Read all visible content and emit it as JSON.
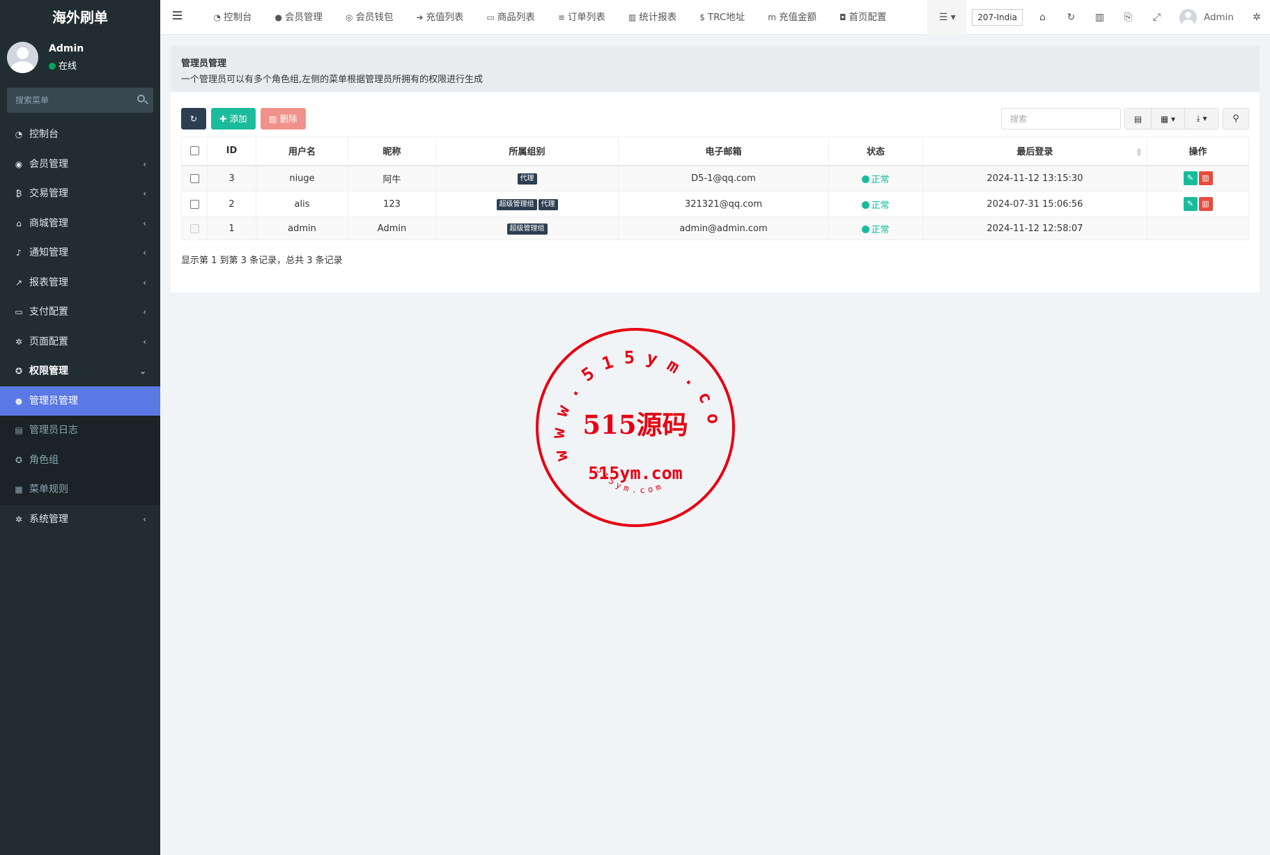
{
  "app": {
    "logo": "海外刷单"
  },
  "user": {
    "name": "Admin",
    "status": "在线"
  },
  "sidebar": {
    "search_placeholder": "搜索菜单",
    "items": [
      {
        "label": "控制台",
        "icon": "dashboard-icon",
        "glyph": "◔"
      },
      {
        "label": "会员管理",
        "icon": "user-circle-icon",
        "glyph": "◉"
      },
      {
        "label": "交易管理",
        "icon": "bitcoin-icon",
        "glyph": "₿"
      },
      {
        "label": "商城管理",
        "icon": "home-icon",
        "glyph": "⌂"
      },
      {
        "label": "通知管理",
        "icon": "bell-icon",
        "glyph": "♪"
      },
      {
        "label": "报表管理",
        "icon": "line-chart-icon",
        "glyph": "↗"
      },
      {
        "label": "支付配置",
        "icon": "credit-card-icon",
        "glyph": "▭"
      },
      {
        "label": "页面配置",
        "icon": "gear-icon",
        "glyph": "✲"
      },
      {
        "label": "权限管理",
        "icon": "group-icon",
        "glyph": "✪"
      }
    ],
    "sub_items": [
      {
        "label": "管理员管理",
        "icon": "user-icon",
        "glyph": "●"
      },
      {
        "label": "管理员日志",
        "icon": "list-icon",
        "glyph": "▤"
      },
      {
        "label": "角色组",
        "icon": "group-icon",
        "glyph": "✪"
      },
      {
        "label": "菜单规则",
        "icon": "windows-icon",
        "glyph": "▦"
      }
    ],
    "last_item": {
      "label": "系统管理",
      "icon": "cogs-icon",
      "glyph": "✲"
    }
  },
  "navbar": {
    "links": [
      {
        "label": "控制台",
        "glyph": "◔",
        "icon": "dashboard-icon"
      },
      {
        "label": "会员管理",
        "glyph": "●",
        "icon": "user-icon"
      },
      {
        "label": "会员钱包",
        "glyph": "◎",
        "icon": "wallet-icon"
      },
      {
        "label": "充值列表",
        "glyph": "➜",
        "icon": "sign-in-icon"
      },
      {
        "label": "商品列表",
        "glyph": "▭",
        "icon": "desktop-icon"
      },
      {
        "label": "订单列表",
        "glyph": "≡",
        "icon": "list-icon"
      },
      {
        "label": "统计报表",
        "glyph": "▥",
        "icon": "bar-chart-icon"
      },
      {
        "label": "TRC地址",
        "glyph": "$",
        "icon": "dollar-icon"
      },
      {
        "label": "充值金额",
        "glyph": "m",
        "icon": "money-icon"
      },
      {
        "label": "首页配置",
        "glyph": "◘",
        "icon": "save-icon"
      }
    ],
    "region": "207-India",
    "user": "Admin"
  },
  "page": {
    "title": "管理员管理",
    "description": "一个管理员可以有多个角色组,左侧的菜单根据管理员所拥有的权限进行生成"
  },
  "toolbar": {
    "add": "添加",
    "delete": "删除",
    "search_placeholder": "搜索"
  },
  "table": {
    "headers": [
      "ID",
      "用户名",
      "昵称",
      "所属组别",
      "电子邮箱",
      "状态",
      "最后登录",
      "操作"
    ],
    "rows": [
      {
        "id": "3",
        "username": "niuge",
        "nickname": "阿牛",
        "groups": [
          "代理"
        ],
        "email": "D5-1@qq.com",
        "status": "正常",
        "last_login": "2024-11-12 13:15:30",
        "actions": true
      },
      {
        "id": "2",
        "username": "alis",
        "nickname": "123",
        "groups": [
          "超级管理组",
          "代理"
        ],
        "email": "321321@qq.com",
        "status": "正常",
        "last_login": "2024-07-31 15:06:56",
        "actions": true
      },
      {
        "id": "1",
        "username": "admin",
        "nickname": "Admin",
        "groups": [
          "超级管理组"
        ],
        "email": "admin@admin.com",
        "status": "正常",
        "last_login": "2024-11-12 12:58:07",
        "actions": false
      }
    ]
  },
  "pager": {
    "text": "显示第 1 到第 3 条记录，总共 3 条记录"
  },
  "watermark": {
    "ring": "www.515ym.com",
    "center": "515源码",
    "url": "515ym.com",
    "small": "515ym.com",
    "color": "#e60012"
  }
}
